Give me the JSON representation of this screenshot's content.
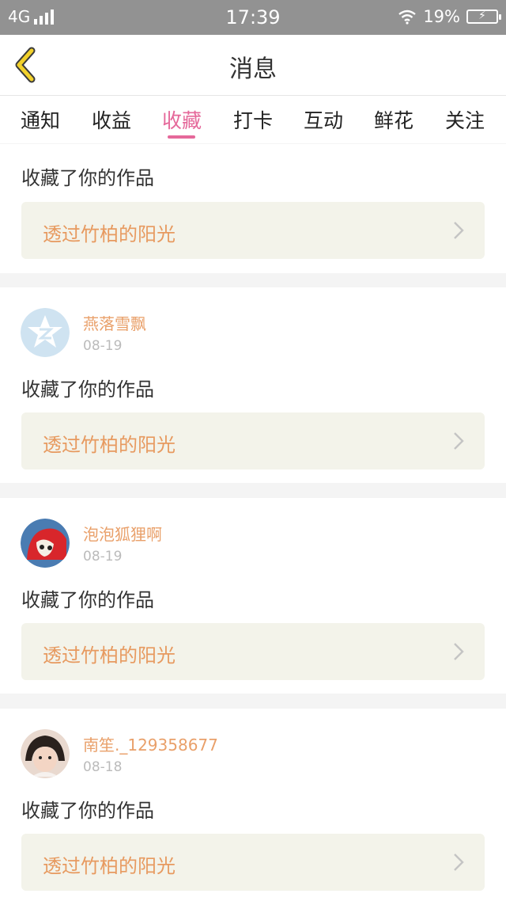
{
  "status_bar": {
    "network": "4G",
    "time": "17:39",
    "battery": "19%"
  },
  "nav": {
    "title": "消息"
  },
  "tabs": [
    {
      "label": "通知",
      "active": false
    },
    {
      "label": "收益",
      "active": false
    },
    {
      "label": "收藏",
      "active": true
    },
    {
      "label": "打卡",
      "active": false
    },
    {
      "label": "互动",
      "active": false
    },
    {
      "label": "鲜花",
      "active": false
    },
    {
      "label": "关注",
      "active": false
    }
  ],
  "notifications": [
    {
      "action": "收藏了你的作品",
      "work_title": "透过竹柏的阳光"
    },
    {
      "username": "燕落雪飘",
      "date": "08-19",
      "avatar": "default-qzone-avatar",
      "action": "收藏了你的作品",
      "work_title": "透过竹柏的阳光"
    },
    {
      "username": "泡泡狐狸啊",
      "date": "08-19",
      "avatar": "fox-avatar",
      "action": "收藏了你的作品",
      "work_title": "透过竹柏的阳光"
    },
    {
      "username": "南笙._129358677",
      "date": "08-18",
      "avatar": "girl-photo-avatar",
      "action": "收藏了你的作品",
      "work_title": "透过竹柏的阳光"
    }
  ],
  "colors": {
    "accent": "#e5689a",
    "username": "#e9a06a",
    "work_title": "#e79a60",
    "work_box": "#f3f3ea",
    "back_icon": "#f2d12b"
  }
}
